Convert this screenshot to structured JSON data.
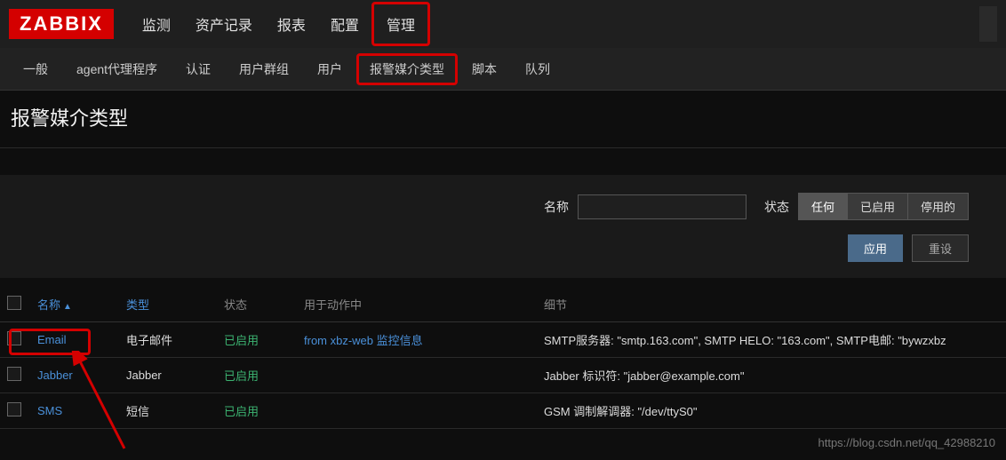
{
  "logo": "ZABBIX",
  "topnav": {
    "items": [
      "监测",
      "资产记录",
      "报表",
      "配置",
      "管理"
    ],
    "active_index": 4
  },
  "subnav": {
    "items": [
      "一般",
      "agent代理程序",
      "认证",
      "用户群组",
      "用户",
      "报警媒介类型",
      "脚本",
      "队列"
    ],
    "active_index": 5
  },
  "page_title": "报警媒介类型",
  "filter": {
    "name_label": "名称",
    "name_value": "",
    "status_label": "状态",
    "status_options": [
      "任何",
      "已启用",
      "停用的"
    ],
    "status_active_index": 0,
    "apply_label": "应用",
    "reset_label": "重设"
  },
  "table": {
    "headers": {
      "name": "名称",
      "type": "类型",
      "status": "状态",
      "action": "用于动作中",
      "details": "细节"
    },
    "sort_col": "name",
    "sort_dir": "▲",
    "rows": [
      {
        "name": "Email",
        "type": "电子邮件",
        "status": "已启用",
        "action_prefix": "from xbz-web ",
        "action_link": "监控信息",
        "details": "SMTP服务器: \"smtp.163.com\", SMTP HELO: \"163.com\", SMTP电邮: \"bywzxbz"
      },
      {
        "name": "Jabber",
        "type": "Jabber",
        "status": "已启用",
        "action_prefix": "",
        "action_link": "",
        "details": "Jabber 标识符: \"jabber@example.com\""
      },
      {
        "name": "SMS",
        "type": "短信",
        "status": "已启用",
        "action_prefix": "",
        "action_link": "",
        "details": "GSM 调制解调器: \"/dev/ttyS0\""
      }
    ]
  },
  "watermark": "https://blog.csdn.net/qq_42988210"
}
